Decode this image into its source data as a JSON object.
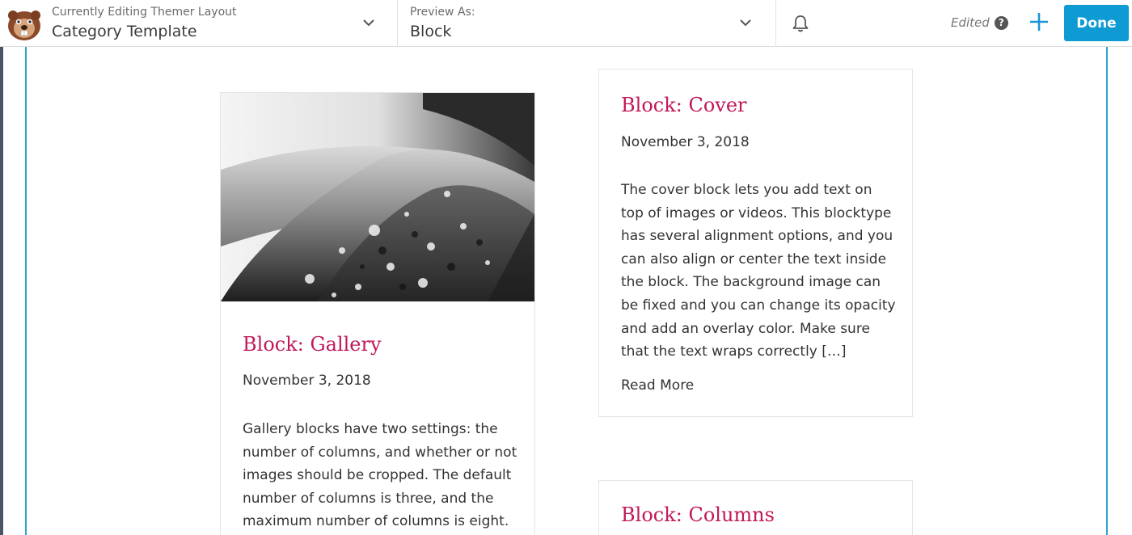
{
  "header": {
    "layout_label": "Currently Editing Themer Layout",
    "layout_value": "Category Template",
    "preview_label": "Preview As:",
    "preview_value": "Block",
    "status": "Edited",
    "help_glyph": "?",
    "done_label": "Done",
    "icons": {
      "logo": "beaver-logo-icon",
      "layout_dropdown": "chevron-down-icon",
      "preview_dropdown": "chevron-down-icon",
      "notifications": "bell-icon",
      "help": "question-circle-icon",
      "add": "plus-icon"
    },
    "accent_color": "#0e9bd4"
  },
  "posts": [
    {
      "title": "Block: Gallery",
      "date": "November 3, 2018",
      "excerpt": "Gallery blocks have two settings: the number of columns, and whether or not images should be cropped. The default number of columns is three, and the maximum number of columns is eight.",
      "has_image": true
    },
    {
      "title": "Block: Cover",
      "date": "November 3, 2018",
      "excerpt": "The cover block lets you add text on top of images or videos. This blocktype has several alignment options, and you can also align or center the text inside the block. The background image can be fixed and you can change its opacity and add an overlay color. Make sure that the text wraps correctly […]",
      "read_more": "Read More"
    },
    {
      "title": "Block: Columns"
    }
  ],
  "colors": {
    "post_title": "#c2185b",
    "row_outline": "#29a3c9"
  }
}
